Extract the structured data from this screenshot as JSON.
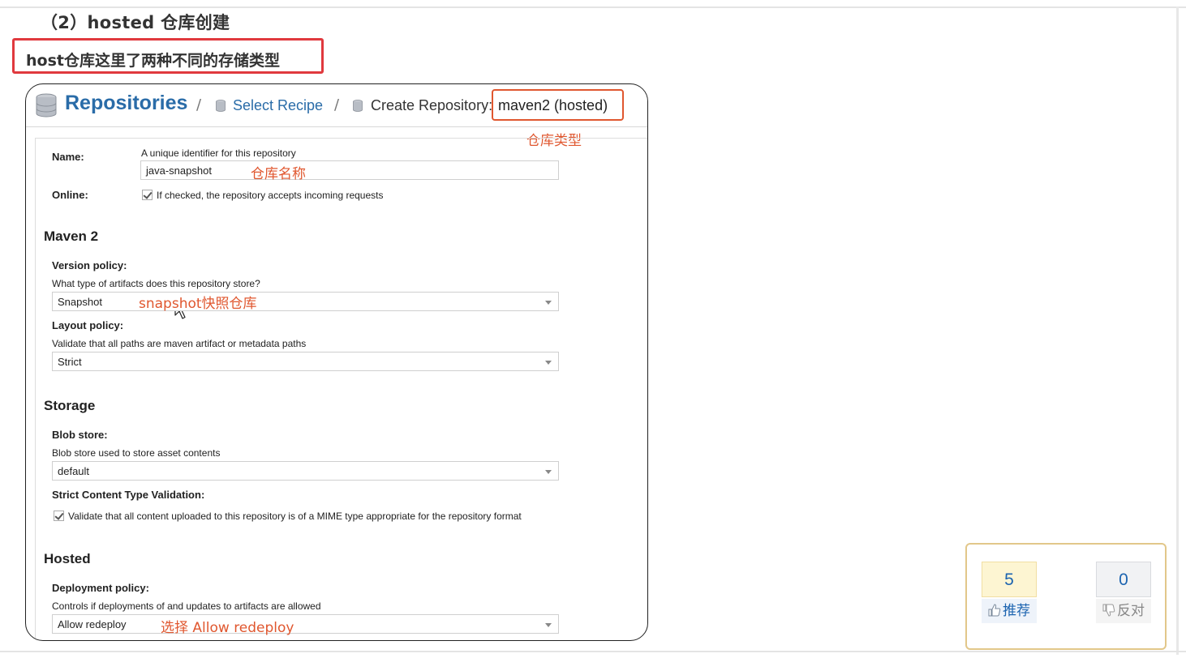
{
  "heading": "（2）hosted 仓库创建",
  "callout_note": "host仓库这里了两种不同的存储类型",
  "breadcrumb": {
    "title": "Repositories",
    "separator": "/",
    "step1": "Select Recipe",
    "step2": "Create Repository:",
    "repo_type": "maven2 (hosted)"
  },
  "form": {
    "name_label": "Name:",
    "name_help": "A unique identifier for this repository",
    "name_value": "java-snapshot",
    "online_label": "Online:",
    "online_help": "If checked, the repository accepts incoming requests",
    "maven_section": "Maven 2",
    "version_policy_label": "Version policy:",
    "version_policy_help": "What type of artifacts does this repository store?",
    "version_policy_value": "Snapshot",
    "layout_policy_label": "Layout policy:",
    "layout_policy_help": "Validate that all paths are maven artifact or metadata paths",
    "layout_policy_value": "Strict",
    "storage_section": "Storage",
    "blob_store_label": "Blob store:",
    "blob_store_help": "Blob store used to store asset contents",
    "blob_store_value": "default",
    "strict_label": "Strict Content Type Validation:",
    "strict_help": "Validate that all content uploaded to this repository is of a MIME type appropriate for the repository format",
    "hosted_section": "Hosted",
    "deployment_label": "Deployment policy:",
    "deployment_help": "Controls if deployments of and updates to artifacts are allowed",
    "deployment_value": "Allow redeploy"
  },
  "annotations": {
    "repo_type": "仓库类型",
    "repo_name": "仓库名称",
    "snapshot": "snapshot快照仓库",
    "redeploy": "选择 Allow redeploy"
  },
  "vote": {
    "up_count": "5",
    "down_count": "0",
    "up_label": "推荐",
    "down_label": "反对"
  },
  "colors": {
    "accent_blue": "#2a6ca8",
    "annotation_orange": "#e0572f",
    "callout_red": "#e0393e"
  }
}
